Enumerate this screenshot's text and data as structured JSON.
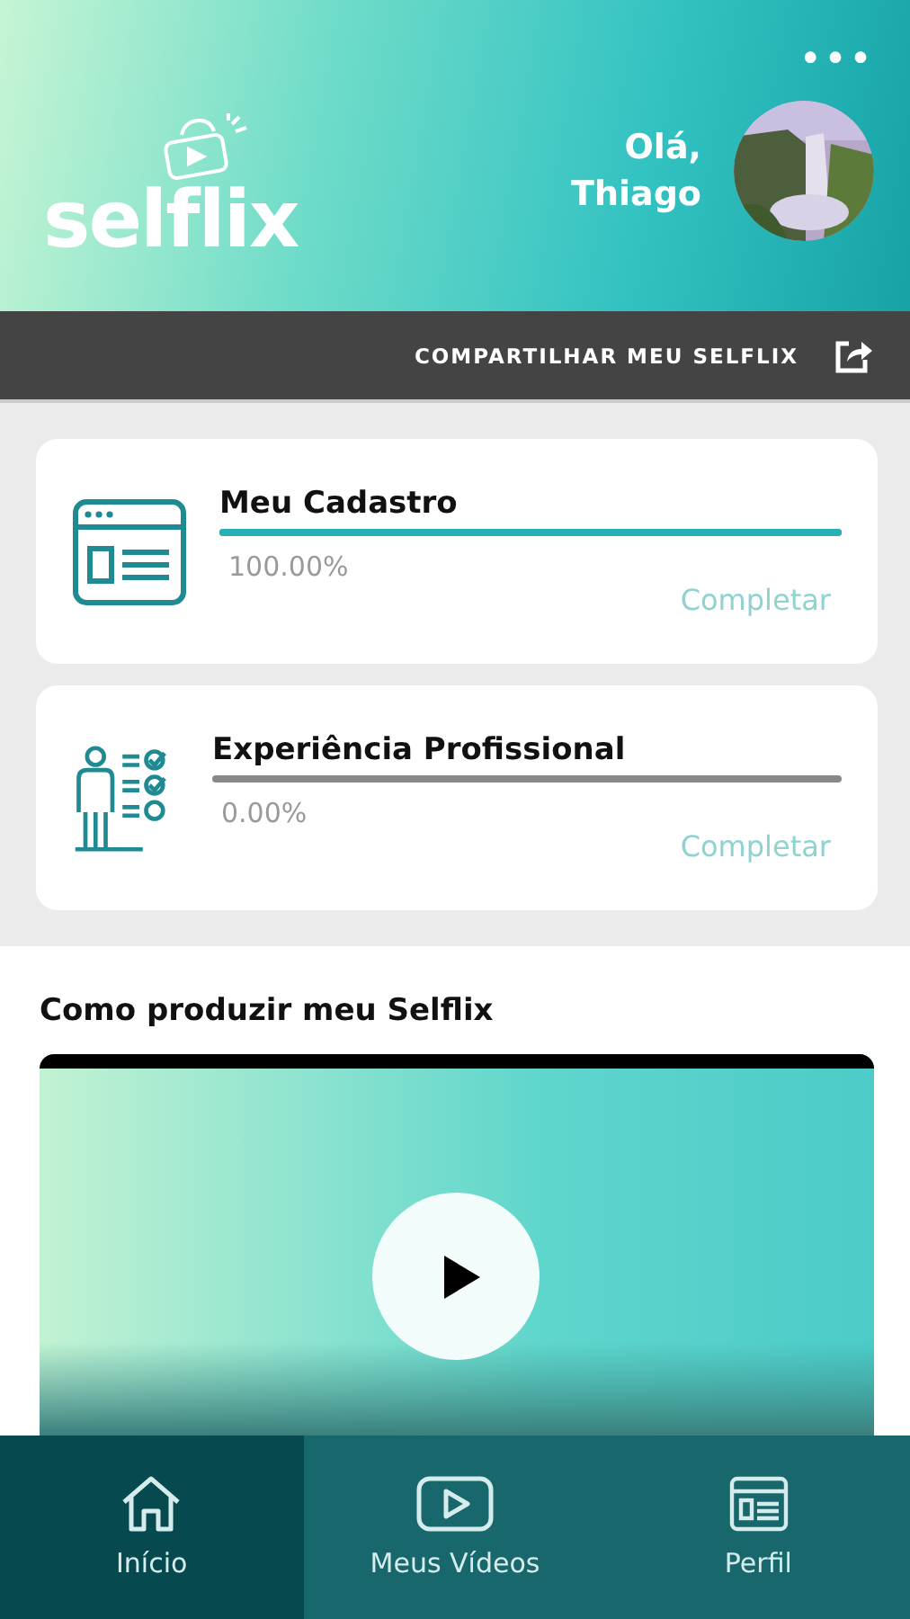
{
  "header": {
    "logo": "selflix",
    "menu_icon": "•••",
    "greeting": "Olá, Thiago"
  },
  "share_bar": {
    "label": "COMPARTILHAR MEU SELFLIX"
  },
  "cards": [
    {
      "kind": "form",
      "title": "Meu Cadastro",
      "level": 1.0,
      "reading": "100.00%",
      "link": "Completar"
    },
    {
      "kind": "checklist",
      "title": "Experiência Profissional",
      "level": 0.0,
      "reading": "0.00%",
      "link": "Completar"
    }
  ],
  "video_section": {
    "title": "Como produzir meu Selflix"
  },
  "nav": [
    {
      "kind": "home",
      "label": "Início",
      "selected": true
    },
    {
      "kind": "video",
      "label": "Meus Vídeos",
      "selected": false
    },
    {
      "kind": "profile",
      "label": "Perfil",
      "selected": false
    }
  ]
}
